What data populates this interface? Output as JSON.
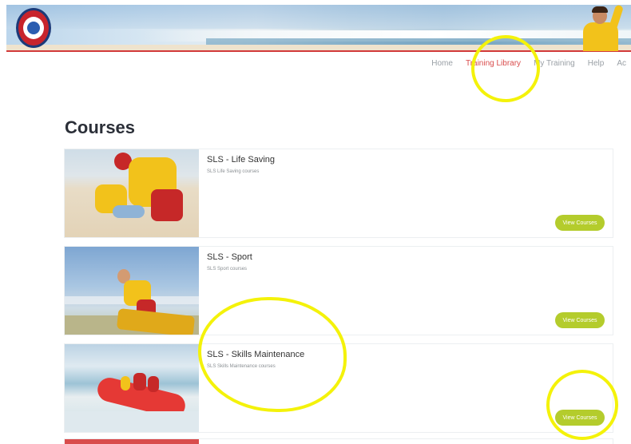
{
  "nav": {
    "items": [
      "Home",
      "Training Library",
      "My Training",
      "Help",
      "Ac"
    ],
    "active_index": 1
  },
  "page": {
    "title": "Courses"
  },
  "courses": [
    {
      "title": "SLS - Life Saving",
      "subtitle": "SLS Life Saving courses",
      "button": "View Courses"
    },
    {
      "title": "SLS - Sport",
      "subtitle": "SLS Sport courses",
      "button": "View Courses"
    },
    {
      "title": "SLS - Skills Maintenance",
      "subtitle": "SLS Skills Maintenance courses",
      "button": "View Courses"
    }
  ],
  "colors": {
    "accent_button": "#b4cc2c",
    "nav_active": "#d94c4c",
    "header_line": "#d23a3a",
    "highlight": "#f4f20a"
  }
}
